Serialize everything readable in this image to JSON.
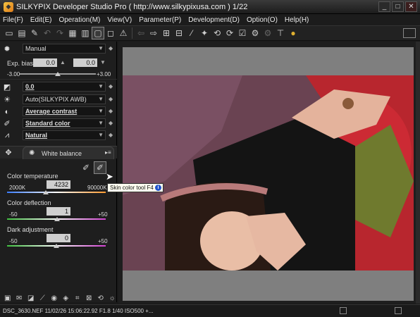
{
  "window": {
    "title": "SILKYPIX Developer Studio Pro ( http://www.silkypixusa.com )   1/22",
    "minimize": "_",
    "maximize": "□",
    "close": "✕"
  },
  "menu": [
    "File(F)",
    "Edit(E)",
    "Operation(M)",
    "View(V)",
    "Parameter(P)",
    "Development(D)",
    "Option(O)",
    "Help(H)"
  ],
  "panel": {
    "exposure_mode": "Manual",
    "exp_bias_label": "Exp. bias",
    "exp_bias_value_1": "0.0",
    "exp_bias_value_2": "0.0",
    "exp_bias_min": "-3.00",
    "exp_bias_max": "+3.00",
    "tone_value": "0.0",
    "white_balance_mode": "Auto(SILKYPIX AWB)",
    "contrast": "Average contrast",
    "color": "Standard color",
    "sharpness": "Natural",
    "wb_section_title": "White balance",
    "color_temperature": {
      "label": "Color temperature",
      "min": "2000K",
      "value": "4232",
      "max": "90000K",
      "fraction": 0.39
    },
    "color_deflection": {
      "label": "Color deflection",
      "min": "-50",
      "value": "1",
      "max": "+50",
      "fraction": 0.51
    },
    "dark_adjustment": {
      "label": "Dark adjustment",
      "min": "-50",
      "value": "0",
      "max": "+50",
      "fraction": 0.5
    }
  },
  "tooltip": {
    "text": "Skin color tool F4",
    "info": "i"
  },
  "status": {
    "text": "DSC_3630.NEF 11/02/26 15:06:22.92 F1.8 1/40 ISO500 +..."
  },
  "colors": {
    "accent": "#2255cc",
    "panel_bg": "#1e1e1e",
    "viewer_bg": "#7f7f7f"
  }
}
